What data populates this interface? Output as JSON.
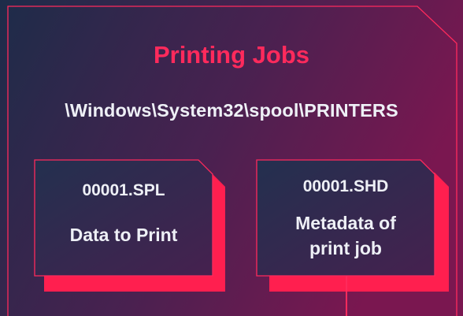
{
  "diagram": {
    "title": "Printing Jobs",
    "folder_path": "\\Windows\\System32\\spool\\PRINTERS",
    "files": [
      {
        "base": "00001.",
        "extension": "SPL",
        "description": "Data to Print"
      },
      {
        "base": "00001.",
        "extension": "SHD",
        "description": "Metadata of print job"
      }
    ],
    "colors": {
      "background_start": "#1d2c49",
      "background_end": "#7a1750",
      "accent": "#ff2a5c",
      "text": "#eef0f6",
      "card_fill": "#2a2c4e"
    }
  }
}
